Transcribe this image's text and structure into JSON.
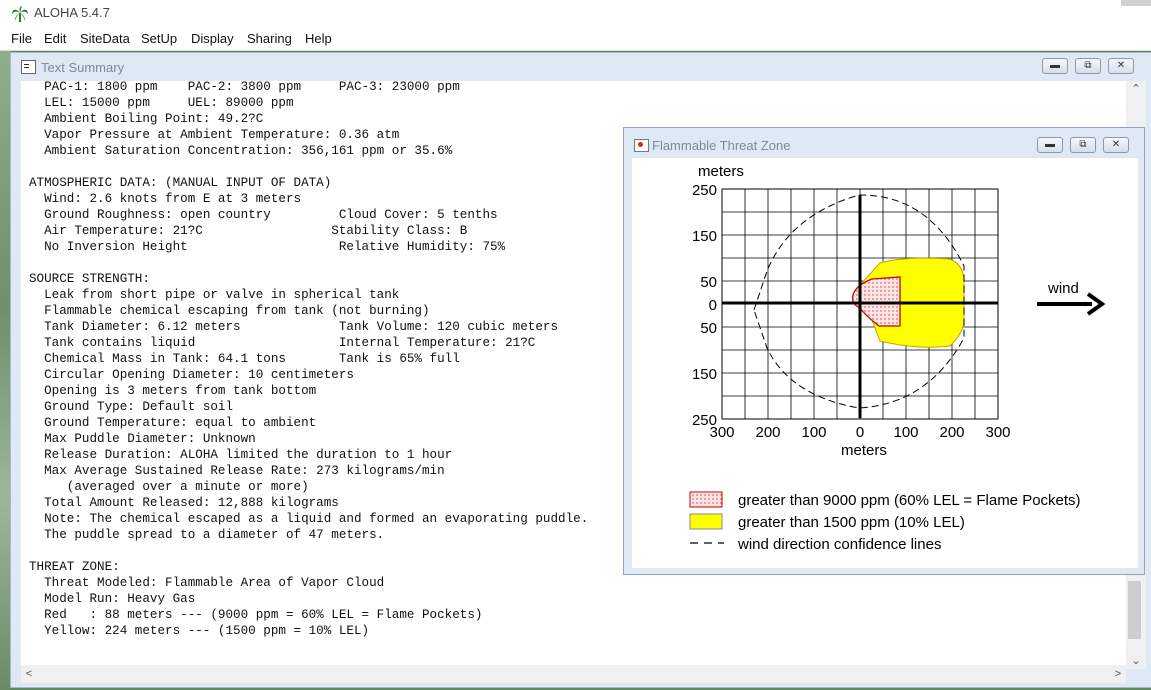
{
  "app": {
    "title": "ALOHA 5.4.7",
    "menu": [
      "File",
      "Edit",
      "SiteData",
      "SetUp",
      "Display",
      "Sharing",
      "Help"
    ]
  },
  "text_summary": {
    "title": "Text Summary",
    "lines": [
      "  PAC-1: 1800 ppm    PAC-2: 3800 ppm     PAC-3: 23000 ppm",
      "  LEL: 15000 ppm     UEL: 89000 ppm",
      "  Ambient Boiling Point: 49.2?C",
      "  Vapor Pressure at Ambient Temperature: 0.36 atm",
      "  Ambient Saturation Concentration: 356,161 ppm or 35.6%",
      "",
      "ATMOSPHERIC DATA: (MANUAL INPUT OF DATA)",
      "  Wind: 2.6 knots from E at 3 meters",
      "  Ground Roughness: open country         Cloud Cover: 5 tenths",
      "  Air Temperature: 21?C                 Stability Class: B",
      "  No Inversion Height                    Relative Humidity: 75%",
      "",
      "SOURCE STRENGTH:",
      "  Leak from short pipe or valve in spherical tank",
      "  Flammable chemical escaping from tank (not burning)",
      "  Tank Diameter: 6.12 meters             Tank Volume: 120 cubic meters",
      "  Tank contains liquid                   Internal Temperature: 21?C",
      "  Chemical Mass in Tank: 64.1 tons       Tank is 65% full",
      "  Circular Opening Diameter: 10 centimeters",
      "  Opening is 3 meters from tank bottom",
      "  Ground Type: Default soil",
      "  Ground Temperature: equal to ambient",
      "  Max Puddle Diameter: Unknown",
      "  Release Duration: ALOHA limited the duration to 1 hour",
      "  Max Average Sustained Release Rate: 273 kilograms/min",
      "     (averaged over a minute or more)",
      "  Total Amount Released: 12,888 kilograms",
      "  Note: The chemical escaped as a liquid and formed an evaporating puddle.",
      "  The puddle spread to a diameter of 47 meters.",
      "",
      "THREAT ZONE:",
      "  Threat Modeled: Flammable Area of Vapor Cloud",
      "  Model Run: Heavy Gas",
      "  Red   : 88 meters --- (9000 ppm = 60% LEL = Flame Pockets)",
      "  Yellow: 224 meters --- (1500 ppm = 10% LEL)"
    ]
  },
  "threat_zone": {
    "title": "Flammable Threat Zone",
    "y_axis_unit": "meters",
    "x_axis_unit": "meters",
    "y_ticks": [
      "250",
      "150",
      "50",
      "0",
      "50",
      "150",
      "250"
    ],
    "x_ticks": [
      "300",
      "200",
      "100",
      "0",
      "100",
      "200",
      "300"
    ],
    "wind_label": "wind",
    "legend": [
      {
        "label": "greater than 9000 ppm (60% LEL = Flame Pockets)",
        "color": "#ffb0b0"
      },
      {
        "label": "greater than 1500 ppm (10% LEL)",
        "color": "#ffff00"
      },
      {
        "label": "wind direction confidence lines",
        "color": "#000000"
      }
    ]
  }
}
